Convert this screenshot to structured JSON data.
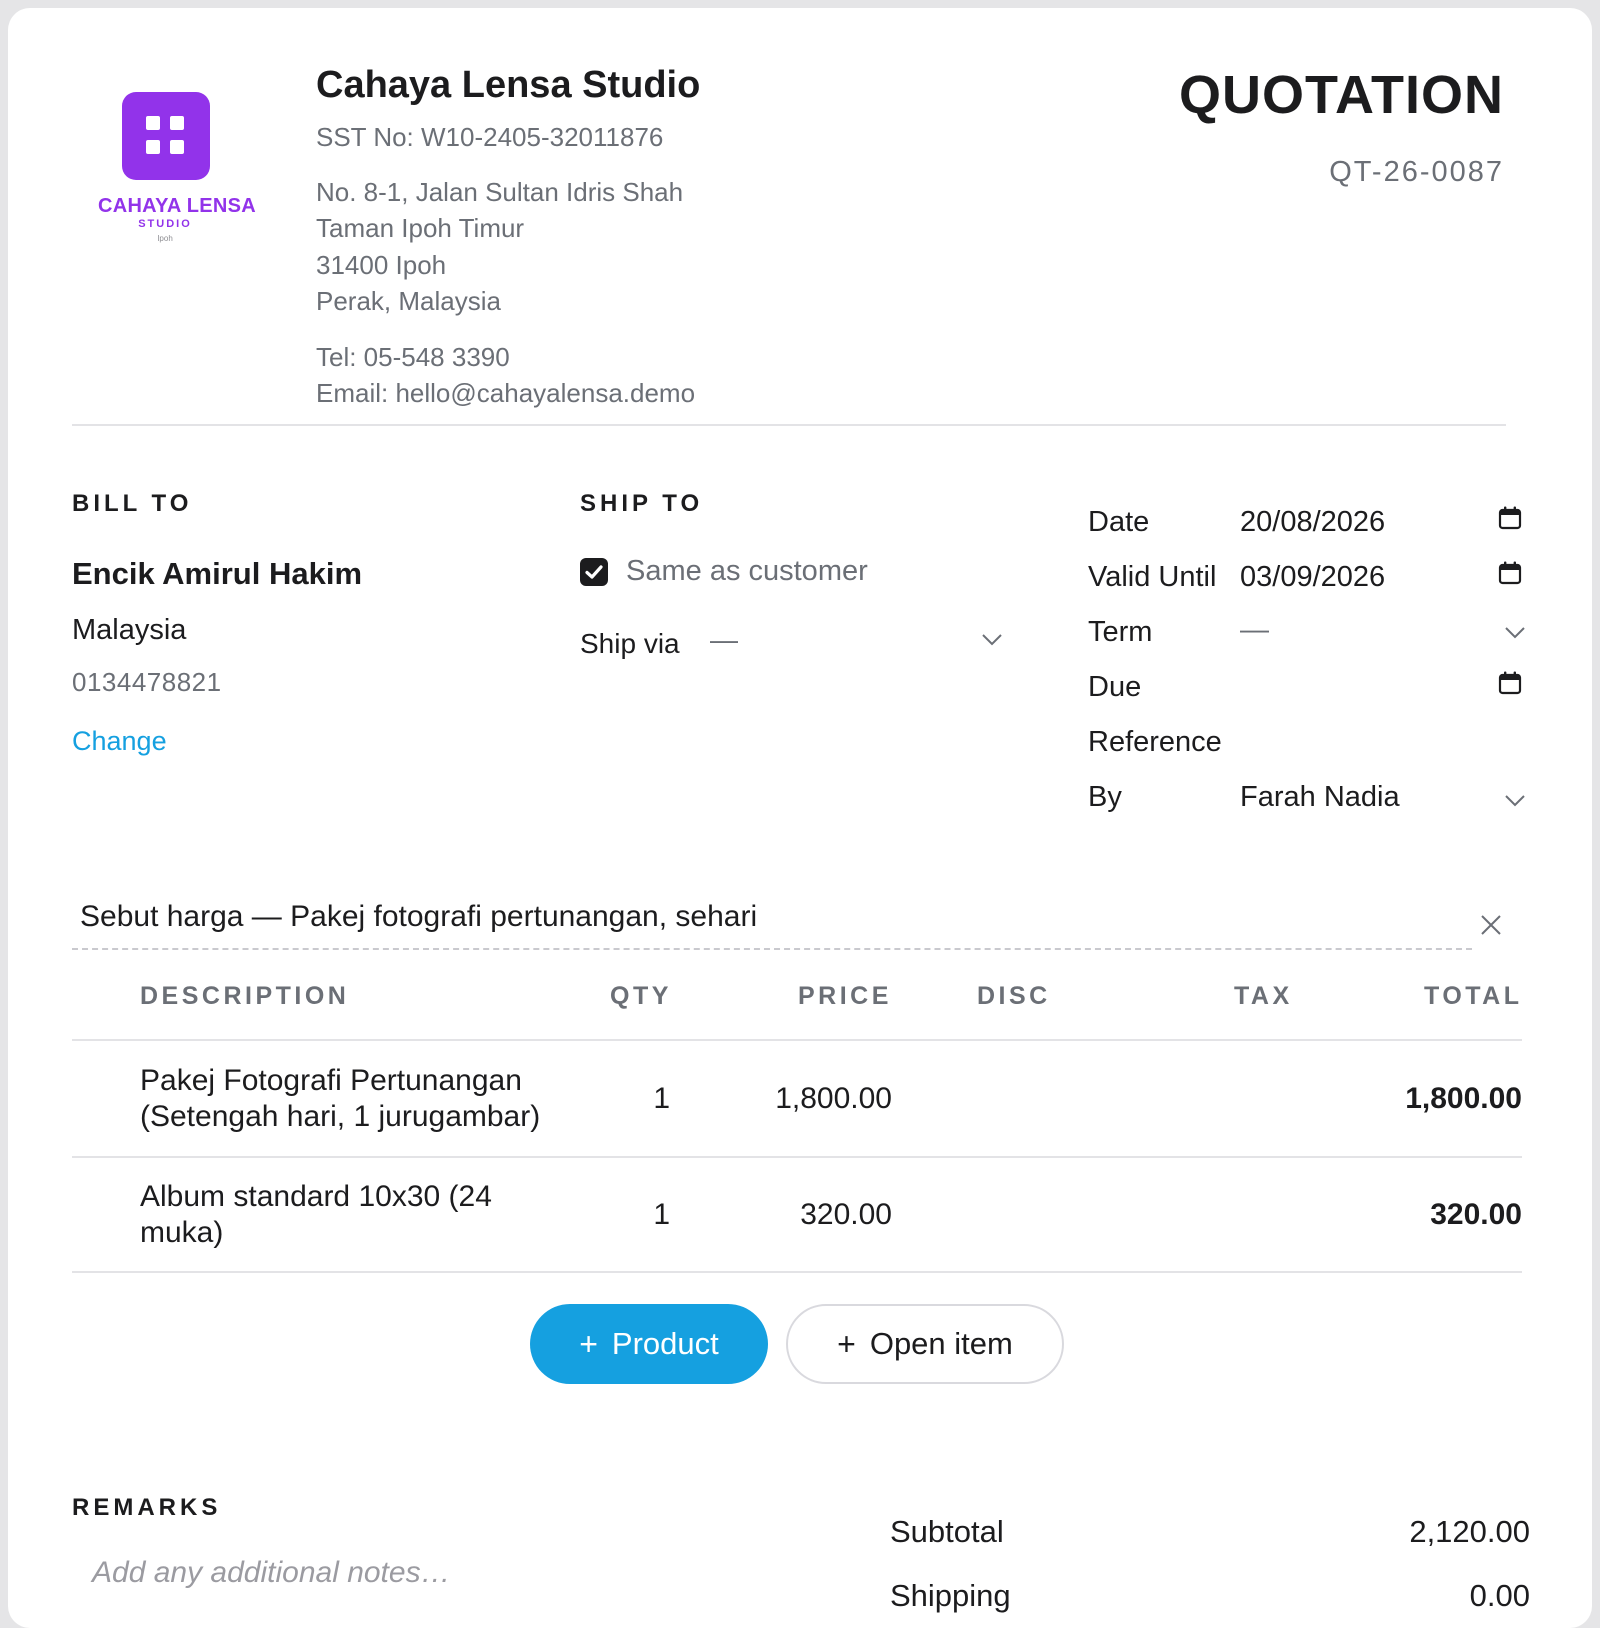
{
  "company": {
    "logo_name": "CAHAYA LENSA",
    "logo_sub": "STUDIO",
    "logo_city": "Ipoh",
    "name": "Cahaya Lensa Studio",
    "sst": "SST No: W10-2405-32011876",
    "address": [
      "No. 8-1, Jalan Sultan Idris Shah",
      "Taman Ipoh Timur",
      "31400 Ipoh",
      "Perak, Malaysia"
    ],
    "tel": "Tel: 05-548 3390",
    "email": "Email: hello@cahayalensa.demo",
    "brand_color": "#9233ea"
  },
  "document": {
    "title": "QUOTATION",
    "number": "QT-26-0087"
  },
  "bill_to": {
    "label": "BILL TO",
    "name": "Encik Amirul Hakim",
    "country": "Malaysia",
    "phone": "0134478821",
    "change_label": "Change"
  },
  "ship_to": {
    "label": "SHIP TO",
    "same_as_customer_label": "Same as customer",
    "same_as_customer_checked": true,
    "ship_via_label": "Ship via",
    "ship_via_value": "—"
  },
  "meta": {
    "date_label": "Date",
    "date_value": "20/08/2026",
    "valid_until_label": "Valid Until",
    "valid_until_value": "03/09/2026",
    "term_label": "Term",
    "term_value": "—",
    "due_label": "Due",
    "due_value": "",
    "reference_label": "Reference",
    "reference_value": "",
    "by_label": "By",
    "by_value": "Farah Nadia"
  },
  "quote_title": "Sebut harga — Pakej fotografi pertunangan, sehari",
  "table": {
    "headers": {
      "description": "DESCRIPTION",
      "qty": "QTY",
      "price": "PRICE",
      "disc": "DISC",
      "tax": "TAX",
      "total": "TOTAL"
    },
    "rows": [
      {
        "description_line1": "Pakej Fotografi Pertunangan",
        "description_line2": "(Setengah hari, 1 jurugambar)",
        "qty": "1",
        "price": "1,800.00",
        "disc": "",
        "tax": "",
        "total": "1,800.00"
      },
      {
        "description_line1": "Album standard 10x30 (24",
        "description_line2": "muka)",
        "qty": "1",
        "price": "320.00",
        "disc": "",
        "tax": "",
        "total": "320.00"
      }
    ]
  },
  "actions": {
    "product_label": "Product",
    "open_item_label": "Open item",
    "plus": "+",
    "accent_color": "#15a0e0"
  },
  "remarks": {
    "label": "REMARKS",
    "placeholder": "Add any additional notes…"
  },
  "summary": {
    "subtotal_label": "Subtotal",
    "subtotal_value": "2,120.00",
    "shipping_label": "Shipping",
    "shipping_value": "0.00"
  }
}
